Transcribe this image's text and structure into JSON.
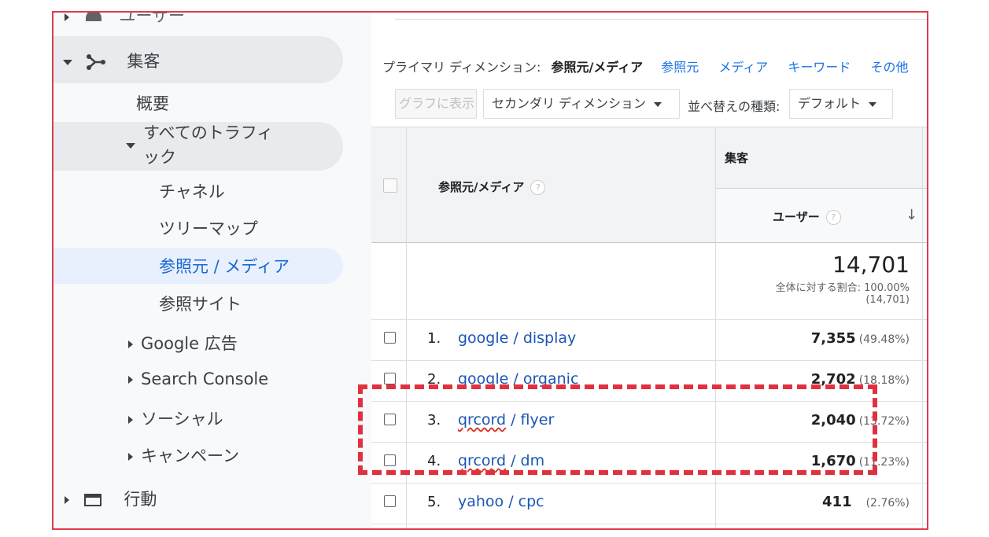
{
  "sidebar": {
    "top_partial_label": "ユーザー",
    "acquisition": "集客",
    "overview": "概要",
    "all_traffic_line1": "すべてのトラフィ",
    "all_traffic_line2": "ック",
    "channels": "チャネル",
    "treemap": "ツリーマップ",
    "source_medium": "参照元 / メディア",
    "referrals": "参照サイト",
    "google_ads": "Google 広告",
    "search_console": "Search Console",
    "social": "ソーシャル",
    "campaigns": "キャンペーン",
    "behavior": "行動"
  },
  "dimension_bar": {
    "label": "プライマリ ディメンション:",
    "current": "参照元/メディア",
    "options": [
      "参照元",
      "メディア",
      "キーワード",
      "その他"
    ]
  },
  "toolbar": {
    "graph_button": "グラフに表示",
    "secondary_dimension": "セカンダリ ディメンション",
    "sort_type_label": "並べ替えの種類:",
    "sort_default": "デフォルト"
  },
  "table": {
    "col_source": "参照元/メディア",
    "group_acquisition": "集客",
    "col_users": "ユーザー",
    "help": "?",
    "total_value": "14,701",
    "total_pct_label": "全体に対する割合: 100.00%",
    "total_paren": "(14,701)",
    "rows": [
      {
        "rank": "1.",
        "source": "google / display",
        "users": "7,355",
        "pct": "(49.48%)"
      },
      {
        "rank": "2.",
        "source": "google / organic",
        "users": "2,702",
        "pct": "(18.18%)"
      },
      {
        "rank": "3.",
        "source_a": "qrcord",
        "source_b": " / flyer",
        "users": "2,040",
        "pct": "(13.72%)"
      },
      {
        "rank": "4.",
        "source_a": "qrcord",
        "source_b": " / dm",
        "users": "1,670",
        "pct": "(11.23%)"
      },
      {
        "rank": "5.",
        "source": "yahoo / cpc",
        "users": "411",
        "pct": "(2.76%)"
      }
    ]
  },
  "colors": {
    "link": "#1a56b4",
    "frame": "#dd3c4c",
    "highlight": "#e0313f",
    "active_nav": "#e8f0fe"
  }
}
